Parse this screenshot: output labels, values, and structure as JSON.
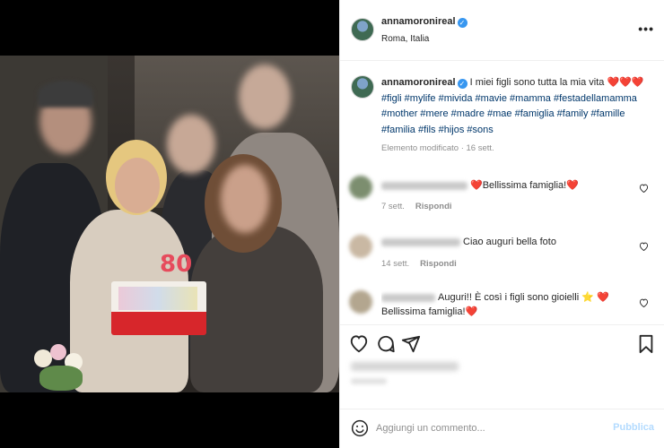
{
  "post": {
    "username": "annamoronireal",
    "location": "Roma, Italia",
    "more_label": "•••",
    "caption_text": "I miei figli sono tutta la mia vita",
    "caption_hearts": "❤️❤️❤️",
    "hashtags": "#figli #mylife #mivida #mavie #mamma #festadellamamma #mother #mere #madre #mae #famiglia #family #famille #familia #fils #hijos #sons",
    "edited_meta": "Elemento modificato · 16 sett."
  },
  "comments": [
    {
      "heart_prefix": "❤️",
      "text": "Bellissima famiglia!",
      "heart_suffix": "❤️",
      "time": "7 sett.",
      "reply": "Rispondi"
    },
    {
      "text": "Ciao auguri bella foto",
      "time": "14 sett.",
      "reply": "Rispondi"
    },
    {
      "text": "Auguri!! È così i figli sono gioielli",
      "star": "⭐",
      "heart": "❤️",
      "text2": "Bellissima famiglia!",
      "tail_heart": "❤️"
    }
  ],
  "add_comment": {
    "placeholder": "Aggiungi un commento...",
    "publish_label": "Pubblica"
  },
  "photo": {
    "candles": "80"
  },
  "colors": {
    "link": "#00376b",
    "verified": "#3897f0",
    "publish_disabled": "#b3dbff",
    "heart": "#dd1111"
  },
  "icons": [
    "heart-icon",
    "comment-icon",
    "share-icon",
    "bookmark-icon",
    "emoji-icon",
    "verified-badge-icon",
    "more-options-icon"
  ]
}
